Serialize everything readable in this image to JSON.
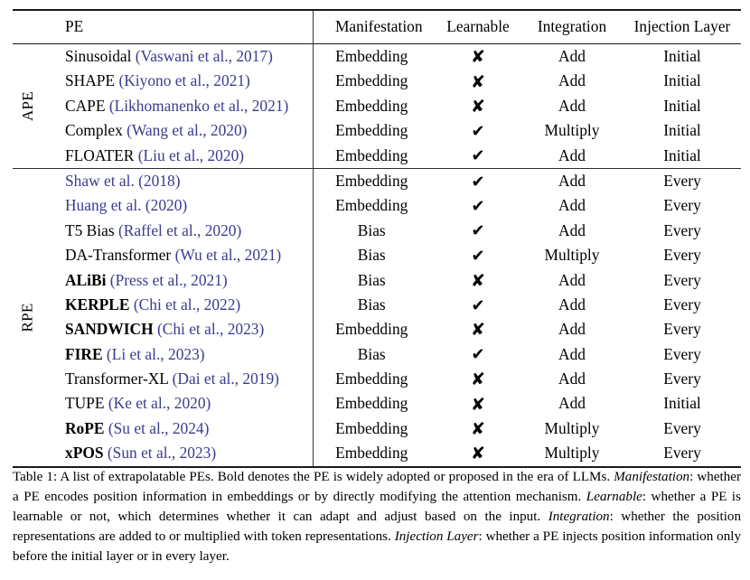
{
  "table": {
    "columns": [
      {
        "key": "pe",
        "label": "PE"
      },
      {
        "key": "man",
        "label": "Manifestation"
      },
      {
        "key": "learn",
        "label": "Learnable"
      },
      {
        "key": "integ",
        "label": "Integration"
      },
      {
        "key": "inject",
        "label": "Injection Layer"
      }
    ],
    "groups": [
      {
        "label": "APE",
        "rows": [
          {
            "name": "Sinusoidal",
            "name_bold": false,
            "cite": "(Vaswani et al., 2017)",
            "cite_only": false,
            "man": "Embedding",
            "learn": "cross",
            "integ": "Add",
            "inject": "Initial"
          },
          {
            "name": "SHAPE",
            "name_bold": false,
            "cite": "(Kiyono et al., 2021)",
            "cite_only": false,
            "man": "Embedding",
            "learn": "cross",
            "integ": "Add",
            "inject": "Initial"
          },
          {
            "name": "CAPE",
            "name_bold": false,
            "cite": "(Likhomanenko et al., 2021)",
            "cite_only": false,
            "man": "Embedding",
            "learn": "cross",
            "integ": "Add",
            "inject": "Initial"
          },
          {
            "name": "Complex",
            "name_bold": false,
            "cite": "(Wang et al., 2020)",
            "cite_only": false,
            "man": "Embedding",
            "learn": "check",
            "integ": "Multiply",
            "inject": "Initial"
          },
          {
            "name": "FLOATER",
            "name_bold": false,
            "cite": "(Liu et al., 2020)",
            "cite_only": false,
            "man": "Embedding",
            "learn": "check",
            "integ": "Add",
            "inject": "Initial"
          }
        ]
      },
      {
        "label": "RPE",
        "rows": [
          {
            "name": "",
            "name_bold": false,
            "cite": "Shaw et al. (2018)",
            "cite_only": true,
            "man": "Embedding",
            "learn": "check",
            "integ": "Add",
            "inject": "Every"
          },
          {
            "name": "",
            "name_bold": false,
            "cite": "Huang et al. (2020)",
            "cite_only": true,
            "man": "Embedding",
            "learn": "check",
            "integ": "Add",
            "inject": "Every"
          },
          {
            "name": "T5 Bias",
            "name_bold": false,
            "cite": "(Raffel et al., 2020)",
            "cite_only": false,
            "man": "Bias",
            "learn": "check",
            "integ": "Add",
            "inject": "Every"
          },
          {
            "name": "DA-Transformer",
            "name_bold": false,
            "cite": "(Wu et al., 2021)",
            "cite_only": false,
            "man": "Bias",
            "learn": "check",
            "integ": "Multiply",
            "inject": "Every"
          },
          {
            "name": "ALiBi",
            "name_bold": true,
            "cite": "(Press et al., 2021)",
            "cite_only": false,
            "man": "Bias",
            "learn": "cross",
            "integ": "Add",
            "inject": "Every"
          },
          {
            "name": "KERPLE",
            "name_bold": true,
            "cite": "(Chi et al., 2022)",
            "cite_only": false,
            "man": "Bias",
            "learn": "check",
            "integ": "Add",
            "inject": "Every"
          },
          {
            "name": "SANDWICH",
            "name_bold": true,
            "cite": "(Chi et al., 2023)",
            "cite_only": false,
            "man": "Embedding",
            "learn": "cross",
            "integ": "Add",
            "inject": "Every"
          },
          {
            "name": "FIRE",
            "name_bold": true,
            "cite": "(Li et al., 2023)",
            "cite_only": false,
            "man": "Bias",
            "learn": "check",
            "integ": "Add",
            "inject": "Every"
          },
          {
            "name": "Transformer-XL",
            "name_bold": false,
            "cite": "(Dai et al., 2019)",
            "cite_only": false,
            "man": "Embedding",
            "learn": "cross",
            "integ": "Add",
            "inject": "Every"
          },
          {
            "name": "TUPE",
            "name_bold": false,
            "cite": "(Ke et al., 2020)",
            "cite_only": false,
            "man": "Embedding",
            "learn": "cross",
            "integ": "Add",
            "inject": "Initial"
          },
          {
            "name": "RoPE",
            "name_bold": true,
            "cite": "(Su et al., 2024)",
            "cite_only": false,
            "man": "Embedding",
            "learn": "cross",
            "integ": "Multiply",
            "inject": "Every"
          },
          {
            "name": "xPOS",
            "name_bold": true,
            "cite": "(Sun et al., 2023)",
            "cite_only": false,
            "man": "Embedding",
            "learn": "cross",
            "integ": "Multiply",
            "inject": "Every"
          }
        ]
      }
    ]
  },
  "marks": {
    "check": "✔",
    "cross": "✘"
  },
  "caption": {
    "label": "Table 1:",
    "segments": [
      {
        "text": " A list of extrapolatable PEs.  Bold denotes the PE is widely adopted or proposed in the era of LLMs. ",
        "italic": false
      },
      {
        "text": "Manifestation",
        "italic": true
      },
      {
        "text": ": whether a PE encodes position information in embeddings or by directly modifying the attention mechanism. ",
        "italic": false
      },
      {
        "text": "Learnable",
        "italic": true
      },
      {
        "text": ": whether a PE is learnable or not, which determines whether it can adapt and adjust based on the input. ",
        "italic": false
      },
      {
        "text": "Integration",
        "italic": true
      },
      {
        "text": ": whether the position representations are added to or multiplied with token representations. ",
        "italic": false
      },
      {
        "text": "Injection Layer",
        "italic": true
      },
      {
        "text": ": whether a PE injects position information only before the initial layer or in every layer.",
        "italic": false
      }
    ]
  },
  "colors": {
    "citation_blue": "#3b3b8f",
    "rule": "#1a1a1a",
    "text": "#000000",
    "background": "#ffffff"
  }
}
